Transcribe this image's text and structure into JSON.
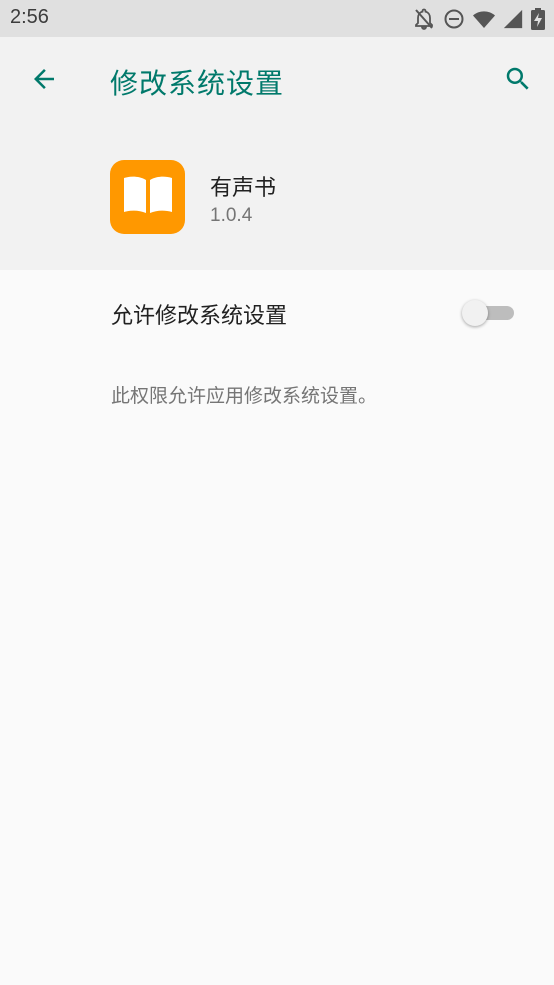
{
  "status_bar": {
    "time": "2:56",
    "icons": [
      "notifications-off-icon",
      "do-not-disturb-icon",
      "wifi-icon",
      "signal-icon",
      "battery-charging-icon"
    ]
  },
  "app_bar": {
    "title": "修改系统设置",
    "back_icon": "arrow-back-icon",
    "search_icon": "search-icon",
    "accent_color": "#00796b"
  },
  "app_info": {
    "name": "有声书",
    "version": "1.0.4",
    "icon": "open-book-icon",
    "icon_color": "#ff9800"
  },
  "setting": {
    "label": "允许修改系统设置",
    "enabled": false
  },
  "summary": "此权限允许应用修改系统设置。"
}
